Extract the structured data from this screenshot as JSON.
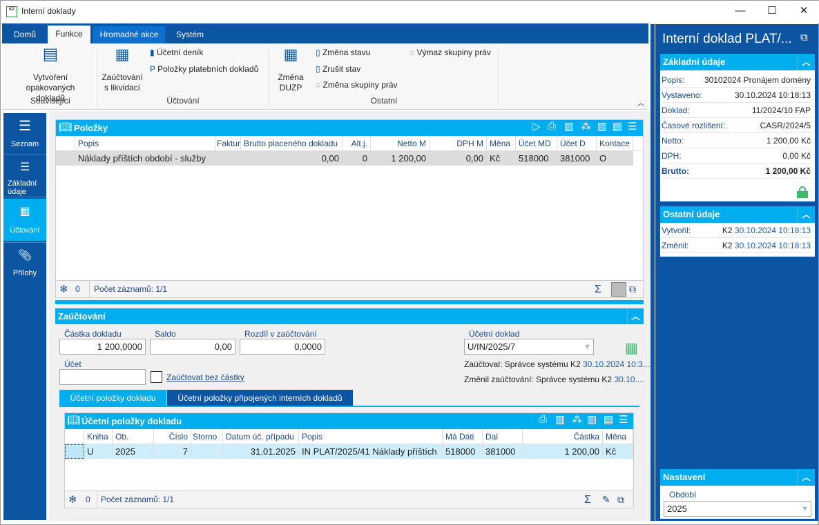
{
  "window": {
    "title": "Interní doklady",
    "logo": "K2",
    "minimize": "—",
    "maximize": "☐",
    "close": "✕"
  },
  "ribbon": {
    "tabs": [
      "Domů",
      "Funkce",
      "Hromadné akce",
      "Systém"
    ],
    "active_tab": "Funkce",
    "groups": {
      "souvisejici": {
        "label": "Související",
        "vytvoreni": "Vytvoření opakovaných dokladů"
      },
      "uctovani": {
        "label": "Účtování",
        "zauctovani": "Zaúčtování s likvidací",
        "ucetni_denik": "Účetní deník",
        "polozky_plat": "Položky platebních dokladů"
      },
      "ostatni": {
        "label": "Ostatní",
        "zmena_duzp": "Změna DUZP",
        "zmena_stavu": "Změna stavu",
        "zrusit_stav": "Zrušit stav",
        "zmena_skupiny": "Změna skupiny práv",
        "vymaz_skupiny": "Výmaz skupiny práv"
      }
    }
  },
  "sidebar": {
    "items": [
      {
        "label": "Seznam",
        "icon": "menu-icon"
      },
      {
        "label": "Základní údaje",
        "icon": "list-icon"
      },
      {
        "label": "Účtování",
        "icon": "calculator-icon"
      },
      {
        "label": "Přílohy",
        "icon": "paperclip-icon"
      }
    ],
    "active": "Účtování"
  },
  "polozky": {
    "title": "Položky",
    "columns": [
      "Popis",
      "Faktur",
      "Brutto placeného dokladu",
      "Alt.j.",
      "Netto M",
      "DPH M",
      "Měna",
      "Účet MD",
      "Účet D",
      "Kontace"
    ],
    "rows": [
      [
        "Náklady příštích období - služby",
        "",
        "0,00",
        "0",
        "1 200,00",
        "0,00",
        "Kč",
        "518000",
        "381000",
        "O"
      ]
    ],
    "footer": {
      "count": "0",
      "records": "Počet záznamů: 1/1",
      "sum": "Σ"
    }
  },
  "zauctovani": {
    "title": "Zaúčtování",
    "castka_label": "Částka dokladu",
    "castka": "1 200,0000",
    "saldo_label": "Saldo",
    "saldo": "0,00",
    "rozdil_label": "Rozdíl v zaúčtování",
    "rozdil": "0,0000",
    "ucet_label": "Účet",
    "ucet": "",
    "bez_castky": "Zaúčtovat bez částky",
    "ucetni_doklad_label": "Účetní doklad",
    "ucetni_doklad": "U/IN/2025/7",
    "zauctoval_label": "Zaúčtoval: Správce systému K2",
    "zauctoval_date": "30.10.2024 10:3...",
    "zmenil_label": "Změnil zaúčtování: Správce systému K2",
    "zmenil_date": "30.10....",
    "tabs": [
      "Účetní položky dokladu",
      "Účetní položky připojených interních dokladů"
    ]
  },
  "ucetni_polozky": {
    "title": "Účetní položky dokladu",
    "columns": [
      "Kniha",
      "Ob.",
      "Číslo",
      "Storno",
      "Datum úč. případu",
      "Popis",
      "Má Dáti",
      "Dal",
      "Částka",
      "Měna"
    ],
    "rows": [
      [
        "U",
        "2025",
        "7",
        "",
        "31.01.2025",
        "IN PLAT/2025/41 Náklady příštích",
        "518000",
        "381000",
        "1 200,00",
        "Kč"
      ]
    ],
    "footer": {
      "count": "0",
      "records": "Počet záznamů: 1/1",
      "sum": "Σ"
    }
  },
  "right_panel": {
    "title": "Interní doklad PLAT/...",
    "zakladni": {
      "title": "Základní údaje",
      "rows": [
        {
          "k": "Popis:",
          "v": "30102024 Pronájem domény"
        },
        {
          "k": "Vystaveno:",
          "v": "30.10.2024 10:18:13"
        },
        {
          "k": "Doklad:",
          "v": "11/2024/10 FAP"
        },
        {
          "k": "Časové rozlišení:",
          "v": "CASR/2024/5"
        },
        {
          "k": "Netto:",
          "v": "1 200,00 Kč"
        },
        {
          "k": "DPH:",
          "v": "0,00 Kč"
        },
        {
          "k": "Brutto:",
          "v": "1 200,00 Kč"
        }
      ]
    },
    "ostatni": {
      "title": "Ostatní údaje",
      "rows": [
        {
          "k": "Vytvořil:",
          "user": "K2",
          "v": "30.10.2024 10:18:13"
        },
        {
          "k": "Změnil:",
          "user": "K2",
          "v": "30.10.2024 10:18:13"
        }
      ]
    },
    "nastaveni": {
      "title": "Nastavení",
      "obdobi_label": "Období",
      "obdobi": "2025"
    }
  },
  "colors": {
    "dark_blue": "#0b55a3",
    "cyan": "#00aeef",
    "lock_green": "#3cb96a"
  }
}
